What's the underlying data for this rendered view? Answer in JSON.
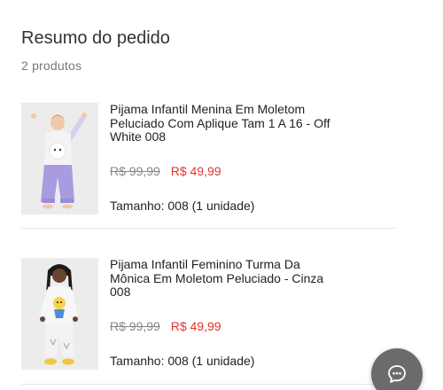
{
  "summary": {
    "title": "Resumo do pedido",
    "count": "2 produtos"
  },
  "products": [
    {
      "name": "Pijama Infantil Menina Em Moletom Peluciado Com Aplique Tam 1 A 16 - Off White 008",
      "old_price": "R$ 99,99",
      "new_price": "R$ 49,99",
      "meta": "Tamanho: 008  (1 unidade)",
      "image_icon": "girl-lilac-pajama-image"
    },
    {
      "name": "Pijama Infantil Feminino Turma Da Mônica Em Moletom Peluciado - Cinza 008",
      "old_price": "R$ 99,99",
      "new_price": "R$ 49,99",
      "meta": "Tamanho: 008  (1 unidade)",
      "image_icon": "girl-white-monica-pajama-image"
    }
  ],
  "chat": {
    "icon": "chat-bubble-icon"
  },
  "colors": {
    "sale_price": "#e3342f",
    "old_price": "#888888",
    "chat_button": "#6b6b6b"
  }
}
